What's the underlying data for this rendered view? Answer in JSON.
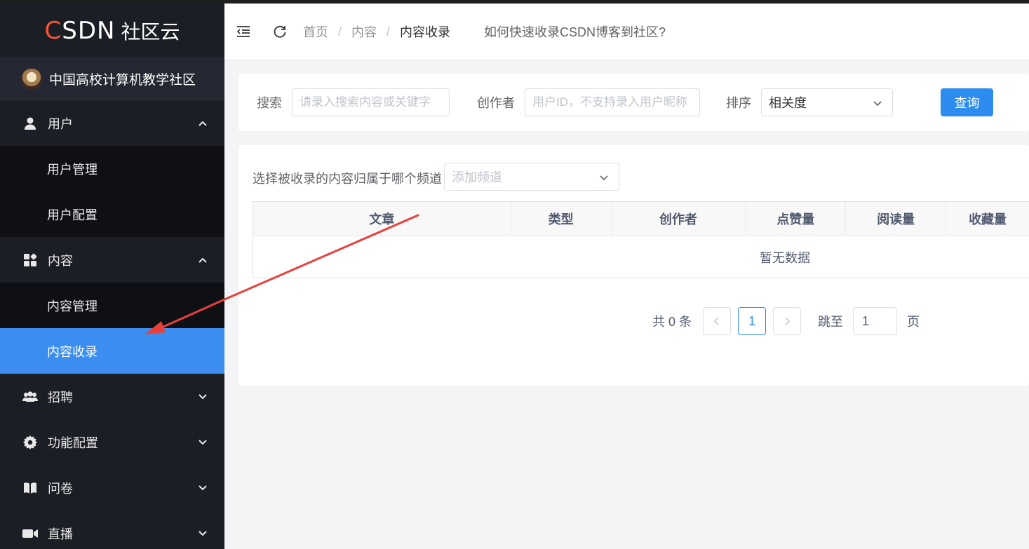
{
  "brand": {
    "logo_text": "CSDN",
    "logo_sub": "社区云"
  },
  "community": {
    "name": "中国高校计算机教学社区"
  },
  "sidebar": {
    "groups": [
      {
        "label": "用户",
        "icon": "user-icon",
        "expanded": true,
        "items": [
          "用户管理",
          "用户配置"
        ]
      },
      {
        "label": "内容",
        "icon": "content-icon",
        "expanded": true,
        "items": [
          "内容管理",
          "内容收录"
        ]
      },
      {
        "label": "招聘",
        "icon": "team-icon",
        "expanded": false
      },
      {
        "label": "功能配置",
        "icon": "gear-icon",
        "expanded": false
      },
      {
        "label": "问卷",
        "icon": "book-icon",
        "expanded": false
      },
      {
        "label": "直播",
        "icon": "video-icon",
        "expanded": false
      }
    ],
    "active_item": "内容收录"
  },
  "header": {
    "breadcrumb": [
      "首页",
      "内容",
      "内容收录"
    ],
    "separator": "/",
    "help_link": "如何快速收录CSDN博客到社区?"
  },
  "search": {
    "keyword_label": "搜索",
    "keyword_placeholder": "请录入搜索内容或关键字",
    "author_label": "创作者",
    "author_placeholder": "用户ID，不支持录入用户昵称",
    "sort_label": "排序",
    "sort_value": "相关度",
    "query_button": "查询"
  },
  "channel": {
    "label": "选择被收录的内容归属于哪个频道",
    "placeholder": "添加频道"
  },
  "table": {
    "columns": [
      "文章",
      "类型",
      "创作者",
      "点赞量",
      "阅读量",
      "收藏量"
    ],
    "empty_text": "暂无数据"
  },
  "pagination": {
    "total_text": "共 0 条",
    "current_page": "1",
    "jump_label": "跳至",
    "jump_value": "1",
    "page_suffix": "页"
  },
  "colors": {
    "accent": "#2d8cf0",
    "sidebar_bg": "#1c1e26",
    "active_bg": "#3b8ef0",
    "brand_c": "#fc5531",
    "arrow": "#e8413b"
  }
}
